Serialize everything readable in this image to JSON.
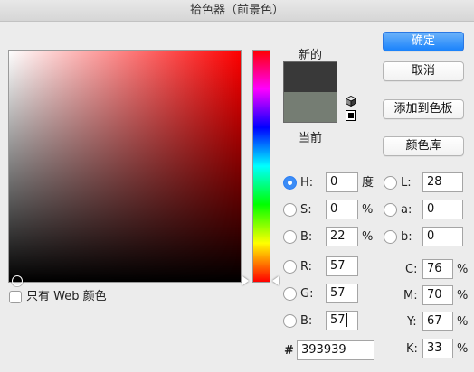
{
  "window": {
    "title": "拾色器（前景色）"
  },
  "preview": {
    "new_label": "新的",
    "current_label": "当前",
    "new_color": "#393939",
    "current_color": "#757d73"
  },
  "buttons": {
    "ok": "确定",
    "cancel": "取消",
    "add_to_swatches": "添加到色板",
    "color_libraries": "颜色库"
  },
  "hsb": {
    "h": {
      "label": "H:",
      "value": "0",
      "unit": "度"
    },
    "s": {
      "label": "S:",
      "value": "0",
      "unit": "%"
    },
    "b": {
      "label": "B:",
      "value": "22",
      "unit": "%"
    }
  },
  "lab": {
    "l": {
      "label": "L:",
      "value": "28"
    },
    "a": {
      "label": "a:",
      "value": "0"
    },
    "b": {
      "label": "b:",
      "value": "0"
    }
  },
  "rgb": {
    "r": {
      "label": "R:",
      "value": "57"
    },
    "g": {
      "label": "G:",
      "value": "57"
    },
    "b": {
      "label": "B:",
      "value": "57"
    }
  },
  "cmyk": {
    "c": {
      "label": "C:",
      "value": "76",
      "unit": "%"
    },
    "m": {
      "label": "M:",
      "value": "70",
      "unit": "%"
    },
    "y": {
      "label": "Y:",
      "value": "67",
      "unit": "%"
    },
    "k": {
      "label": "K:",
      "value": "33",
      "unit": "%"
    }
  },
  "hex": {
    "label": "#",
    "value": "393939"
  },
  "web_only": {
    "label": "只有 Web 颜色",
    "checked": false
  },
  "selected_mode": "H"
}
